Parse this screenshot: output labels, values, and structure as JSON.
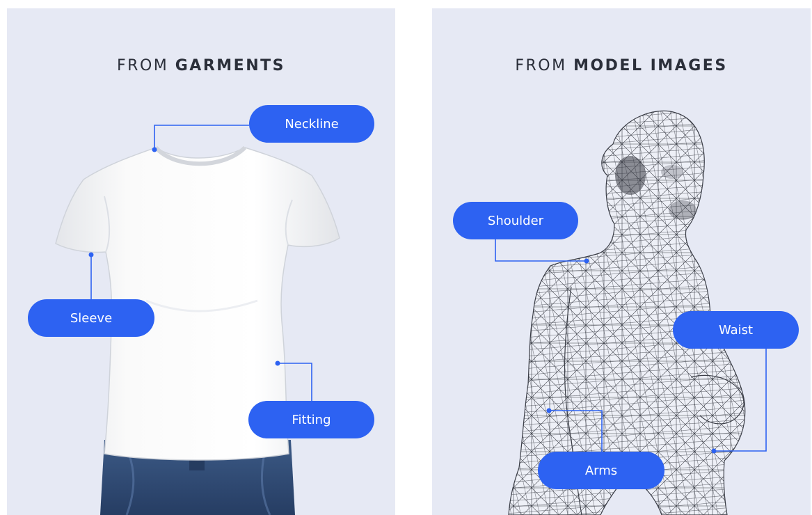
{
  "panels": [
    {
      "title_prefix": "FROM ",
      "title_emphasis": "GARMENTS",
      "labels": [
        "Neckline",
        "Sleeve",
        "Fitting"
      ]
    },
    {
      "title_prefix": "FROM ",
      "title_emphasis": "MODEL IMAGES",
      "labels": [
        "Shoulder",
        "Waist",
        "Arms"
      ]
    }
  ],
  "colors": {
    "panel_background": "#e6e9f4",
    "accent": "#2d62f2",
    "title_text": "#2b2f3a"
  }
}
